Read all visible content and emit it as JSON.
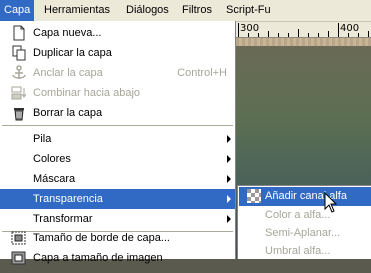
{
  "menubar": {
    "items": [
      {
        "label": "Capa",
        "active": true
      },
      {
        "label": "Herramientas"
      },
      {
        "label": "Diálogos"
      },
      {
        "label": "Filtros"
      },
      {
        "label": "Script-Fu"
      }
    ]
  },
  "ruler": {
    "label_300": "300",
    "label_400": "400"
  },
  "menu": {
    "items": [
      {
        "label": "Capa nueva...",
        "icon": "new-layer-icon"
      },
      {
        "label": "Duplicar la capa",
        "icon": "duplicate-layer-icon"
      },
      {
        "label": "Anclar la capa",
        "accel": "Control+H",
        "disabled": true,
        "icon": "anchor-icon"
      },
      {
        "label": "Combinar hacia abajo",
        "disabled": true,
        "icon": "merge-down-icon"
      },
      {
        "label": "Borrar la capa",
        "icon": "trash-icon"
      },
      {
        "label": "Pila"
      },
      {
        "label": "Colores"
      },
      {
        "label": "Máscara"
      },
      {
        "label": "Transparencia",
        "selected": true
      },
      {
        "label": "Transformar"
      },
      {
        "label": "Tamaño de borde de capa...",
        "icon": "layer-boundary-size-icon"
      },
      {
        "label": "Capa a tamaño de imagen",
        "icon": "layer-to-image-size-icon"
      }
    ]
  },
  "submenu": {
    "items": [
      {
        "label": "Añadir canal alfa",
        "selected": true,
        "icon": "add-alpha-icon"
      },
      {
        "label": "Color a alfa...",
        "disabled": true
      },
      {
        "label": "Semi-Aplanar...",
        "disabled": true
      },
      {
        "label": "Umbral alfa...",
        "disabled": true
      }
    ]
  },
  "colors": {
    "menu_highlight": "#316ac5",
    "menubar_bg": "#ece9d8",
    "disabled_text": "#a7a69a"
  }
}
